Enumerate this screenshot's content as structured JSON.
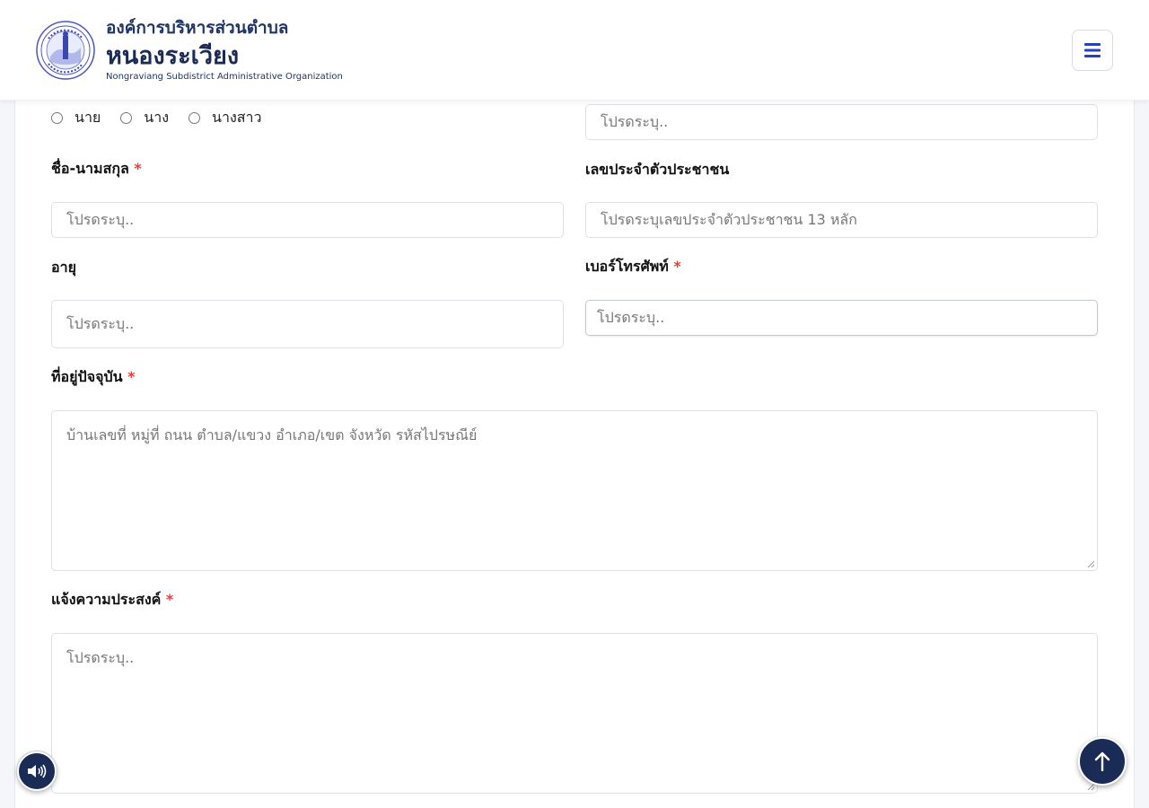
{
  "header": {
    "org_line1": "องค์การบริหารส่วนตำบล",
    "org_line2": "หนองระเวียง",
    "org_line3": "Nongraviang Subdistrict Administrative Organization",
    "menu_icon": "hamburger-icon"
  },
  "form": {
    "title_options": [
      {
        "label": "นาย",
        "selected": false
      },
      {
        "label": "นาง",
        "selected": false
      },
      {
        "label": "นางสาว",
        "selected": false
      }
    ],
    "top_right_placeholder": "โปรดระบุ..",
    "fullname": {
      "label": "ชื่อ-นามสกุล",
      "required": "*",
      "placeholder": "โปรดระบุ.."
    },
    "id_number": {
      "label": "เลขประจำตัวประชาชน",
      "placeholder": "โปรดระบุเลขประจำตัวประชาชน 13 หลัก"
    },
    "age": {
      "label": "อายุ",
      "placeholder": "โปรดระบุ.."
    },
    "phone": {
      "label": "เบอร์โทรศัพท์",
      "required": "*",
      "placeholder": "โปรดระบุ.."
    },
    "address": {
      "label": "ที่อยู่ปัจจุบัน",
      "required": "*",
      "placeholder": "บ้านเลขที่ หมู่ที่ ถนน ตำบล/แขวง อำเภอ/เขต จังหวัด รหัสไปรษณีย์"
    },
    "purpose": {
      "label": "แจ้งความประสงค์",
      "required": "*",
      "placeholder": "โปรดระบุ.."
    }
  },
  "floating": {
    "audio_icon": "speaker-icon",
    "top_icon": "arrow-up-icon"
  },
  "colors": {
    "brand": "#1a2b55",
    "menu_icon": "#2741b8",
    "required": "#e0403a"
  }
}
